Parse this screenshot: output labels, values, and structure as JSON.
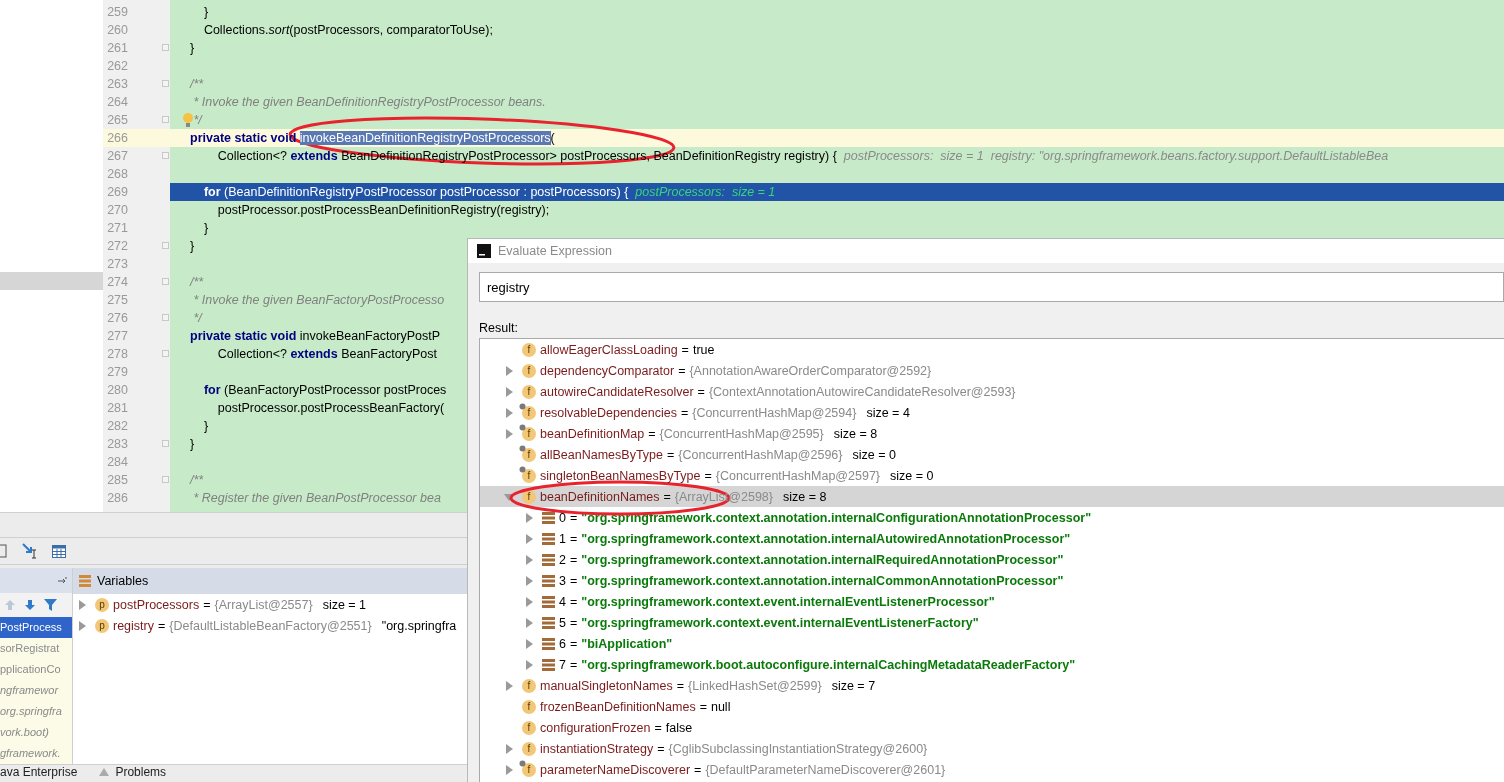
{
  "editor": {
    "side_highlight": true,
    "lines": [
      {
        "number": "259",
        "fold": false,
        "segments": [
          {
            "kind": "code",
            "text": "    }"
          }
        ]
      },
      {
        "number": "260",
        "fold": false,
        "segments": [
          {
            "kind": "code",
            "text": "    Collections."
          },
          {
            "kind": "static",
            "text": "sort"
          },
          {
            "kind": "code",
            "text": "(postProcessors, comparatorToUse);"
          }
        ]
      },
      {
        "number": "261",
        "fold": true,
        "segments": [
          {
            "kind": "code",
            "text": "}"
          }
        ]
      },
      {
        "number": "262",
        "fold": false
      },
      {
        "number": "263",
        "fold": true,
        "segments": [
          {
            "kind": "comment",
            "text": "/**"
          }
        ]
      },
      {
        "number": "264",
        "fold": false,
        "segments": [
          {
            "kind": "comment",
            "text": " * Invoke the given BeanDefinitionRegistryPostProcessor beans."
          }
        ]
      },
      {
        "number": "265",
        "fold": true,
        "bulb": true,
        "segments": [
          {
            "kind": "comment",
            "text": " */"
          }
        ]
      },
      {
        "number": "266",
        "caret_line": true,
        "fold": false,
        "segments": [
          {
            "kind": "keyword",
            "text": "private static void "
          },
          {
            "kind": "selection",
            "text": "invokeBeanDefinitionRegistryPostProcessors"
          },
          {
            "kind": "code",
            "text": "("
          }
        ]
      },
      {
        "number": "267",
        "fold": true,
        "segments": [
          {
            "kind": "code",
            "text": "        Collection<? "
          },
          {
            "kind": "keyword",
            "text": "extends"
          },
          {
            "kind": "code",
            "text": " BeanDefinitionRegistryPostProcessor> postProcessors, BeanDefinitionRegistry registry) {  "
          },
          {
            "kind": "hint",
            "text": "postProcessors:  size = 1  registry: \"org.springframework.beans.factory.support.DefaultListableBea"
          }
        ]
      },
      {
        "number": "268",
        "fold": false
      },
      {
        "number": "269",
        "execution_point": true,
        "fold": false,
        "segments": [
          {
            "kind": "keyword",
            "text": "    for"
          },
          {
            "kind": "code",
            "text": " (BeanDefinitionRegistryPostProcessor postProcessor : postProcessors) {  "
          },
          {
            "kind": "hint",
            "text": "postProcessors:  size = 1"
          }
        ]
      },
      {
        "number": "270",
        "fold": false,
        "segments": [
          {
            "kind": "code",
            "text": "        postProcessor.postProcessBeanDefinitionRegistry(registry);"
          }
        ]
      },
      {
        "number": "271",
        "fold": false,
        "segments": [
          {
            "kind": "code",
            "text": "    }"
          }
        ]
      },
      {
        "number": "272",
        "fold": true,
        "segments": [
          {
            "kind": "code",
            "text": "}"
          }
        ]
      },
      {
        "number": "273",
        "fold": false
      },
      {
        "number": "274",
        "fold": true,
        "segments": [
          {
            "kind": "comment",
            "text": "/**"
          }
        ]
      },
      {
        "number": "275",
        "fold": false,
        "segments": [
          {
            "kind": "comment",
            "text": " * Invoke the given BeanFactoryPostProcesso"
          }
        ]
      },
      {
        "number": "276",
        "fold": true,
        "segments": [
          {
            "kind": "comment",
            "text": " */"
          }
        ]
      },
      {
        "number": "277",
        "fold": false,
        "segments": [
          {
            "kind": "keyword",
            "text": "private static void"
          },
          {
            "kind": "code",
            "text": " invokeBeanFactoryPostP"
          }
        ]
      },
      {
        "number": "278",
        "fold": true,
        "segments": [
          {
            "kind": "code",
            "text": "        Collection<? "
          },
          {
            "kind": "keyword",
            "text": "extends"
          },
          {
            "kind": "code",
            "text": " BeanFactoryPost"
          }
        ]
      },
      {
        "number": "279",
        "fold": false
      },
      {
        "number": "280",
        "fold": false,
        "segments": [
          {
            "kind": "keyword",
            "text": "    for"
          },
          {
            "kind": "code",
            "text": " (BeanFactoryPostProcessor postProces"
          }
        ]
      },
      {
        "number": "281",
        "fold": false,
        "segments": [
          {
            "kind": "code",
            "text": "        postProcessor.postProcessBeanFactory("
          }
        ]
      },
      {
        "number": "282",
        "fold": false,
        "segments": [
          {
            "kind": "code",
            "text": "    }"
          }
        ]
      },
      {
        "number": "283",
        "fold": true,
        "segments": [
          {
            "kind": "code",
            "text": "}"
          }
        ]
      },
      {
        "number": "284",
        "fold": false
      },
      {
        "number": "285",
        "fold": true,
        "segments": [
          {
            "kind": "comment",
            "text": "/**"
          }
        ]
      },
      {
        "number": "286",
        "fold": false,
        "segments": [
          {
            "kind": "comment",
            "text": " * Register the given BeanPostProcessor bea"
          }
        ]
      }
    ]
  },
  "frames": {
    "items": [
      {
        "text": "PostProcess",
        "selected": true,
        "kind": "app"
      },
      {
        "text": "sorRegistrat",
        "selected": false,
        "kind": "app"
      },
      {
        "text": "pplicationCo",
        "selected": false,
        "kind": "app"
      },
      {
        "text": "ngframewor",
        "selected": false,
        "kind": "library"
      },
      {
        "text": "org.springfra",
        "selected": false,
        "kind": "library"
      },
      {
        "text": "vork.boot)",
        "selected": false,
        "kind": "library"
      },
      {
        "text": "gframework.",
        "selected": false,
        "kind": "library"
      }
    ]
  },
  "variables": {
    "title": "Variables",
    "rows": [
      {
        "badge": "p",
        "name": "postProcessors",
        "op": "=",
        "ref": "{ArrayList@2557}",
        "value": "size = 1"
      },
      {
        "badge": "p",
        "name": "registry",
        "op": "=",
        "ref": "{DefaultListableBeanFactory@2551}",
        "value": "\"org.springfra"
      }
    ]
  },
  "bottom_tabs": [
    {
      "label": "ava Enterprise",
      "kind": "plain"
    },
    {
      "label": "Problems",
      "kind": "warning"
    }
  ],
  "dialog": {
    "title": "Evaluate Expression",
    "expression": "registry",
    "result_label": "Result:",
    "tree": [
      {
        "kind": "field",
        "badge": "f",
        "final": false,
        "expandable": false,
        "selected": false,
        "name": "allowEagerClassLoading",
        "op": "=",
        "value": "true"
      },
      {
        "kind": "field",
        "badge": "f",
        "final": false,
        "expandable": true,
        "expanded": false,
        "selected": false,
        "name": "dependencyComparator",
        "op": "=",
        "ref": "{AnnotationAwareOrderComparator@2592}"
      },
      {
        "kind": "field",
        "badge": "f",
        "final": false,
        "expandable": true,
        "expanded": false,
        "selected": false,
        "name": "autowireCandidateResolver",
        "op": "=",
        "ref": "{ContextAnnotationAutowireCandidateResolver@2593}"
      },
      {
        "kind": "field",
        "badge": "f",
        "final": true,
        "expandable": true,
        "expanded": false,
        "selected": false,
        "name": "resolvableDependencies",
        "op": "=",
        "ref": "{ConcurrentHashMap@2594}",
        "value": "size = 4"
      },
      {
        "kind": "field",
        "badge": "f",
        "final": true,
        "expandable": true,
        "expanded": false,
        "selected": false,
        "name": "beanDefinitionMap",
        "op": "=",
        "ref": "{ConcurrentHashMap@2595}",
        "value": "size = 8"
      },
      {
        "kind": "field",
        "badge": "f",
        "final": true,
        "expandable": false,
        "selected": false,
        "name": "allBeanNamesByType",
        "op": "=",
        "ref": "{ConcurrentHashMap@2596}",
        "value": "size = 0"
      },
      {
        "kind": "field",
        "badge": "f",
        "final": true,
        "expandable": false,
        "selected": false,
        "name": "singletonBeanNamesByType",
        "op": "=",
        "ref": "{ConcurrentHashMap@2597}",
        "value": "size = 0"
      },
      {
        "kind": "field",
        "badge": "f",
        "final": false,
        "expandable": true,
        "expanded": true,
        "selected": true,
        "name": "beanDefinitionNames",
        "op": "=",
        "ref": "{ArrayList@2598}",
        "value": "size = 8",
        "children": [
          {
            "kind": "element",
            "expandable": true,
            "expanded": false,
            "selected": false,
            "name": "0",
            "op": "=",
            "value": "\"org.springframework.context.annotation.internalConfigurationAnnotationProcessor\""
          },
          {
            "kind": "element",
            "expandable": true,
            "expanded": false,
            "selected": false,
            "name": "1",
            "op": "=",
            "value": "\"org.springframework.context.annotation.internalAutowiredAnnotationProcessor\""
          },
          {
            "kind": "element",
            "expandable": true,
            "expanded": false,
            "selected": false,
            "name": "2",
            "op": "=",
            "value": "\"org.springframework.context.annotation.internalRequiredAnnotationProcessor\""
          },
          {
            "kind": "element",
            "expandable": true,
            "expanded": false,
            "selected": false,
            "name": "3",
            "op": "=",
            "value": "\"org.springframework.context.annotation.internalCommonAnnotationProcessor\""
          },
          {
            "kind": "element",
            "expandable": true,
            "expanded": false,
            "selected": false,
            "name": "4",
            "op": "=",
            "value": "\"org.springframework.context.event.internalEventListenerProcessor\""
          },
          {
            "kind": "element",
            "expandable": true,
            "expanded": false,
            "selected": false,
            "name": "5",
            "op": "=",
            "value": "\"org.springframework.context.event.internalEventListenerFactory\""
          },
          {
            "kind": "element",
            "expandable": true,
            "expanded": false,
            "selected": false,
            "name": "6",
            "op": "=",
            "value": "\"biApplication\""
          },
          {
            "kind": "element",
            "expandable": true,
            "expanded": false,
            "selected": false,
            "name": "7",
            "op": "=",
            "value": "\"org.springframework.boot.autoconfigure.internalCachingMetadataReaderFactory\""
          }
        ]
      },
      {
        "kind": "field",
        "badge": "f",
        "final": false,
        "expandable": true,
        "expanded": false,
        "selected": false,
        "name": "manualSingletonNames",
        "op": "=",
        "ref": "{LinkedHashSet@2599}",
        "value": "size = 7"
      },
      {
        "kind": "field",
        "badge": "f",
        "final": false,
        "expandable": false,
        "selected": false,
        "name": "frozenBeanDefinitionNames",
        "op": "=",
        "value": "null"
      },
      {
        "kind": "field",
        "badge": "f",
        "final": false,
        "expandable": false,
        "selected": false,
        "name": "configurationFrozen",
        "op": "=",
        "value": "false"
      },
      {
        "kind": "field",
        "badge": "f",
        "final": false,
        "expandable": true,
        "expanded": false,
        "selected": false,
        "name": "instantiationStrategy",
        "op": "=",
        "ref": "{CglibSubclassingInstantiationStrategy@2600}"
      },
      {
        "kind": "field",
        "badge": "f",
        "final": true,
        "expandable": true,
        "expanded": false,
        "selected": false,
        "name": "parameterNameDiscoverer",
        "op": "=",
        "ref": "{DefaultParameterNameDiscoverer@2601}"
      }
    ]
  }
}
